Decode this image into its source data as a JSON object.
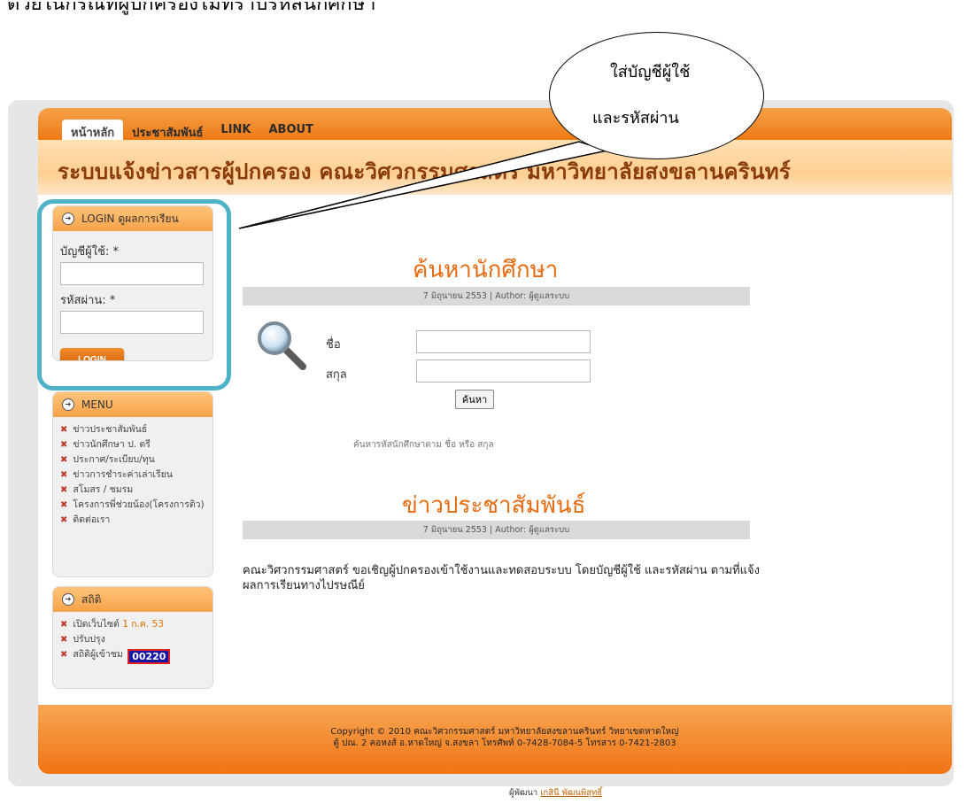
{
  "caption": "ด้วยในกรณีที่ผู้ปกครองไม่ทราบรหัสนักศึกษา",
  "callout": {
    "line1": "ใส่บัญชีผู้ใช้",
    "line2": "และรหัสผ่าน"
  },
  "nav": {
    "items": [
      "หน้าหลัก",
      "ประชาสัมพันธ์",
      "LINK",
      "ABOUT"
    ]
  },
  "site_title": "ระบบแจ้งข่าวสารผู้ปกครอง คณะวิศวกรรมศาสตร์ มหาวิทยาลัยสงขลานครินทร์",
  "login": {
    "heading": "LOGIN ดูผลการเรียน",
    "username_label": "บัญชีผู้ใช้: *",
    "password_label": "รหัสผ่าน: *",
    "button_label": "LOGIN"
  },
  "menu": {
    "heading": "MENU",
    "items": [
      "ข่าวประชาสัมพันธ์",
      "ข่าวนักศึกษา ป. ตรี",
      "ประกาศ/ระเบียบ/ทุน",
      "ข่าวการชำระค่าเล่าเรียน",
      "สโมสร / ชมรม",
      "โครงการพี่ช่วยน้อง(โครงการติว)",
      "ติดต่อเรา"
    ]
  },
  "stats": {
    "heading": "สถิติ",
    "opened_label": "เปิดเว็บไซต์",
    "opened_date": "1 ก.ค. 53",
    "updated_label": "ปรับปรุง",
    "visitors_label": "สถิติผู้เข้าชม",
    "visitors_count": "00220"
  },
  "search_section": {
    "title": "ค้นหานักศึกษา",
    "meta": "7 มิถุนายน 2553 | Author: ผู้ดูแลระบบ",
    "first_name_label": "ชื่อ",
    "last_name_label": "สกุล",
    "button_label": "ค้นหา",
    "hint": "ค้นหารหัสนักศึกษาตาม ชื่อ หรือ สกุล"
  },
  "news_section": {
    "title": "ข่าวประชาสัมพันธ์",
    "meta": "7 มิถุนายน 2553 | Author: ผู้ดูแลระบบ",
    "body": "คณะวิศวกรรมศาสตร์ ขอเชิญผู้ปกครองเข้าใช้งานและทดสอบระบบ โดยบัญชีผู้ใช้ และรหัสผ่าน ตามที่แจ้งผลการเรียนทางไปรษณีย์"
  },
  "footer": {
    "line1": "Copyright © 2010 คณะวิศวกรรมศาสตร์ มหาวิทยาลัยสงขลานครินทร์ วิทยาเขตหาดใหญ่",
    "line2": "ตู้ ปณ. 2 คอหงส์ อ.หาดใหญ่ จ.สงขลา โทรศัพท์ 0-7428-7084-5 โทรสาร 0-7421-2803"
  },
  "developer": {
    "label": "ผู้พัฒนา",
    "name": "เกสินี พัฒนพิสุทธิ์"
  }
}
